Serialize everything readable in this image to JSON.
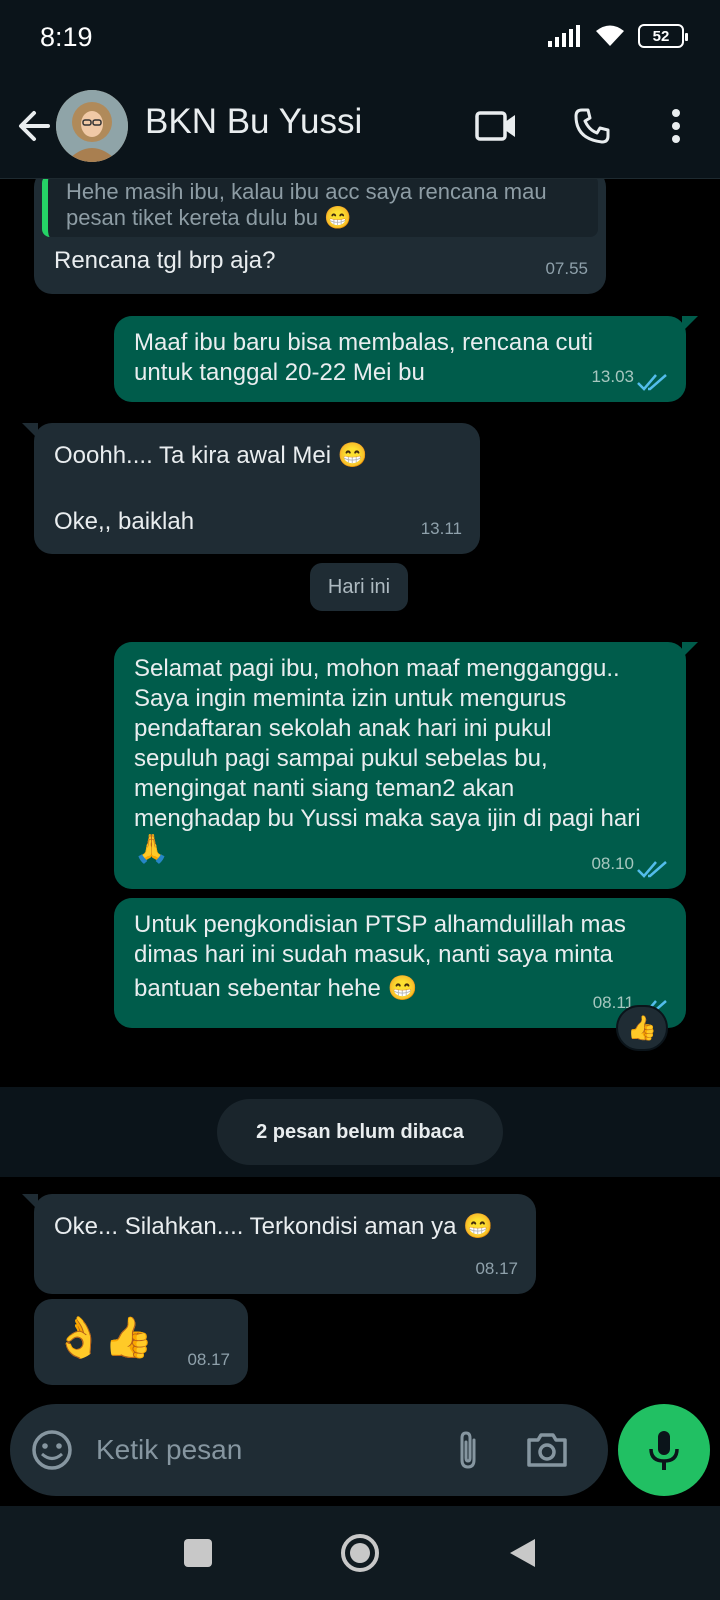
{
  "status": {
    "time": "8:19",
    "battery": "52"
  },
  "header": {
    "name": "BKN Bu Yussi"
  },
  "messages": {
    "m1": {
      "quote": "Hehe masih ibu, kalau ibu acc saya rencana mau pesan tiket kereta dulu bu 😁",
      "text": "Rencana tgl brp aja?",
      "time": "07.55"
    },
    "m2": {
      "line1": "Maaf ibu baru bisa membalas, rencana cuti",
      "line2": "untuk tanggal 20-22 Mei bu",
      "time": "13.03"
    },
    "m3": {
      "line1": "Ooohh.... Ta kira awal Mei 😁",
      "line2": "Oke,, baiklah",
      "time": "13.11"
    },
    "date_chip": "Hari ini",
    "m4": {
      "l1": "Selamat pagi ibu, mohon maaf mengganggu..",
      "l2": "Saya ingin meminta izin untuk mengurus",
      "l3": "pendaftaran sekolah anak hari ini pukul",
      "l4": "sepuluh pagi sampai pukul sebelas bu,",
      "l5": "mengingat nanti siang teman2 akan",
      "l6": "menghadap bu Yussi maka saya ijin di pagi hari",
      "l7": "🙏",
      "time": "08.10"
    },
    "m5": {
      "l1": "Untuk pengkondisian PTSP alhamdulillah mas",
      "l2": "dimas hari ini sudah masuk, nanti saya minta",
      "l3": "bantuan sebentar hehe 😁",
      "time": "08.11",
      "reaction": "👍"
    },
    "unread": "2 pesan belum dibaca",
    "m6": {
      "text": "Oke... Silahkan.... Terkondisi aman ya 😁",
      "time": "08.17"
    },
    "m7": {
      "text": "👌👍",
      "time": "08.17"
    }
  },
  "composer": {
    "placeholder": "Ketik pesan"
  },
  "colors": {
    "incoming": "#1f2c34",
    "outgoing": "#005c4b",
    "accent": "#21c063",
    "read_ticks": "#53bdeb"
  }
}
